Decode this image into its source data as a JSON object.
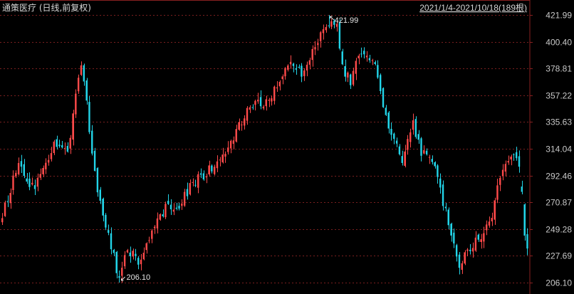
{
  "chart_data": {
    "type": "candlestick",
    "title": "通策医疗 (日线,前复权)",
    "date_range": "2021/1/4-2021/10/18(189根)",
    "y_ticks": [
      421.99,
      400.4,
      378.81,
      357.22,
      335.63,
      314.04,
      292.46,
      270.87,
      249.28,
      227.69,
      206.1
    ],
    "y_tick_labels": [
      "421.99",
      "400.40",
      "378.81",
      "357.22",
      "335.63",
      "314.04",
      "292.46",
      "270.87",
      "249.28",
      "227.69",
      "206.10"
    ],
    "ylim": [
      206.1,
      421.99
    ],
    "grid": true,
    "colors": {
      "up": "#ff4a4a",
      "down": "#22d4e8",
      "grid": "#7a1f1f",
      "border": "#8a2020",
      "text": "#d0d0d0"
    },
    "annotations": [
      {
        "label": "421.99",
        "value": 421.99,
        "bar_index": 120,
        "kind": "high"
      },
      {
        "label": "206.10",
        "value": 206.1,
        "bar_index": 43,
        "kind": "low"
      }
    ],
    "anchors": [
      [
        0,
        262
      ],
      [
        6,
        302
      ],
      [
        12,
        280
      ],
      [
        16,
        305
      ],
      [
        20,
        320
      ],
      [
        24,
        312
      ],
      [
        28,
        370
      ],
      [
        29,
        385
      ],
      [
        31,
        350
      ],
      [
        34,
        295
      ],
      [
        36,
        268
      ],
      [
        39,
        245
      ],
      [
        43,
        209
      ],
      [
        46,
        232
      ],
      [
        50,
        224
      ],
      [
        55,
        246
      ],
      [
        60,
        268
      ],
      [
        64,
        265
      ],
      [
        69,
        282
      ],
      [
        73,
        292
      ],
      [
        78,
        300
      ],
      [
        84,
        318
      ],
      [
        89,
        343
      ],
      [
        94,
        352
      ],
      [
        98,
        350
      ],
      [
        103,
        375
      ],
      [
        106,
        385
      ],
      [
        110,
        372
      ],
      [
        114,
        393
      ],
      [
        118,
        408
      ],
      [
        120,
        421
      ],
      [
        123,
        413
      ],
      [
        125,
        380
      ],
      [
        128,
        368
      ],
      [
        131,
        388
      ],
      [
        134,
        388
      ],
      [
        137,
        384
      ],
      [
        140,
        345
      ],
      [
        144,
        322
      ],
      [
        147,
        300
      ],
      [
        151,
        336
      ],
      [
        154,
        312
      ],
      [
        158,
        305
      ],
      [
        162,
        270
      ],
      [
        166,
        238
      ],
      [
        168,
        218
      ],
      [
        171,
        232
      ],
      [
        175,
        240
      ],
      [
        180,
        262
      ],
      [
        183,
        292
      ],
      [
        186,
        302
      ],
      [
        188,
        313
      ],
      [
        190,
        300
      ],
      [
        191,
        275
      ],
      [
        192,
        244
      ],
      [
        193,
        236
      ]
    ]
  }
}
